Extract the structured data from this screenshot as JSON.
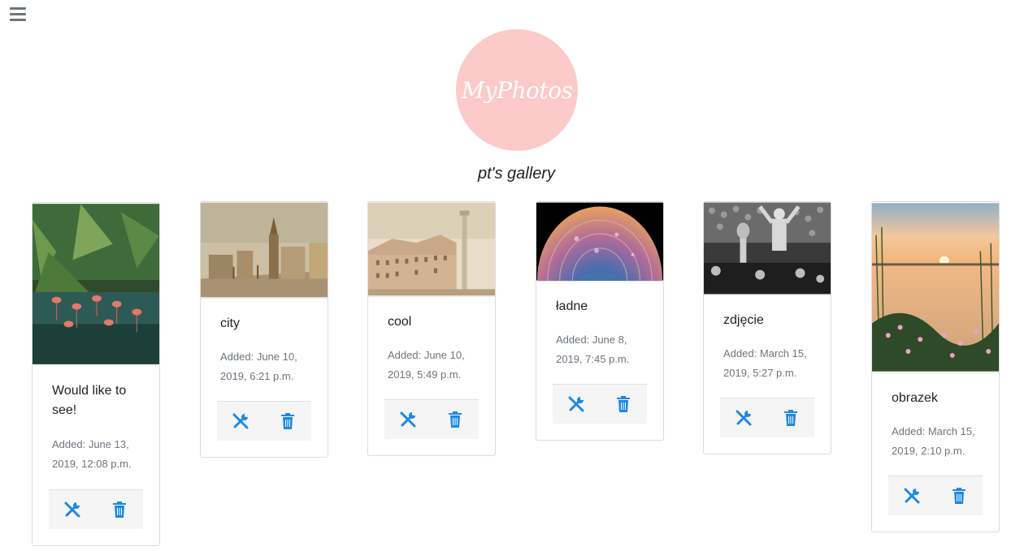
{
  "logo_text": "MyPhotos",
  "gallery_title": "pt's gallery",
  "colors": {
    "logo_bg": "#fccac9",
    "icon_blue": "#1e88e5",
    "muted_text": "#6c757d"
  },
  "icons": {
    "menu": "hamburger-icon",
    "edit": "tools-icon",
    "delete": "trash-icon"
  },
  "photos": [
    {
      "title": "Would like to see!",
      "date": "Added: June 13, 2019, 12:08 p.m."
    },
    {
      "title": "city",
      "date": "Added: June 10, 2019, 6:21 p.m."
    },
    {
      "title": "cool",
      "date": "Added: June 10, 2019, 5:49 p.m."
    },
    {
      "title": "ładne",
      "date": "Added: June 8, 2019, 7:45 p.m."
    },
    {
      "title": "zdjęcie",
      "date": "Added: March 15, 2019, 5:27 p.m."
    },
    {
      "title": "obrazek",
      "date": "Added: March 15, 2019, 2:10 p.m."
    }
  ]
}
